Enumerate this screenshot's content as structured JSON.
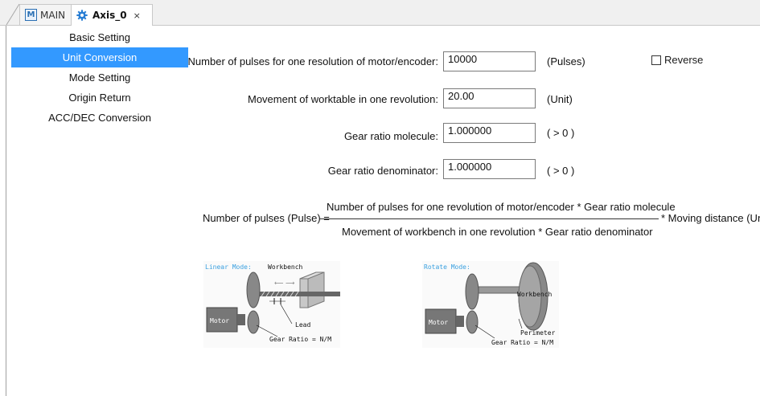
{
  "tabs": [
    {
      "label": "MAIN",
      "icon": "m-icon"
    },
    {
      "label": "Axis_0",
      "icon": "gear-icon",
      "close": "×"
    }
  ],
  "nav": {
    "items": [
      {
        "label": "Basic Setting"
      },
      {
        "label": "Unit Conversion",
        "active": true
      },
      {
        "label": "Mode Setting"
      },
      {
        "label": "Origin Return"
      },
      {
        "label": "ACC/DEC Conversion"
      }
    ]
  },
  "form": {
    "pulses": {
      "label": "Number of pulses for one resolution of motor/encoder:",
      "value": "10000",
      "unit": "(Pulses)"
    },
    "movement": {
      "label": "Movement of worktable in one revolution:",
      "value": "20.00",
      "unit": "(Unit)"
    },
    "gear_molecule": {
      "label": "Gear ratio molecule:",
      "value": "1.000000",
      "unit": "( > 0 )"
    },
    "gear_denominator": {
      "label": "Gear ratio denominator:",
      "value": "1.000000",
      "unit": "( > 0 )"
    },
    "reverse": {
      "label": "Reverse",
      "checked": false
    }
  },
  "formula": {
    "lhs": "Number of pulses (Pulse) =",
    "numerator": "Number of pulses for one revolution of motor/encoder * Gear ratio molecule",
    "denominator": "Movement of workbench in one revolution *  Gear ratio denominator",
    "rhs": "* Moving distance (Unit)"
  },
  "diagrams": {
    "linear": {
      "mode": "Linear Mode:",
      "workbench": "Workbench",
      "motor": "Motor",
      "lead": "Lead",
      "gear_ratio": "Gear Ratio = N/M"
    },
    "rotate": {
      "mode": "Rotate Mode:",
      "workbench": "Workbench",
      "motor": "Motor",
      "perimeter": "Perimeter",
      "gear_ratio": "Gear Ratio = N/M"
    }
  },
  "colors": {
    "accent": "#3399ff",
    "mode_label": "#3aa0e0"
  }
}
